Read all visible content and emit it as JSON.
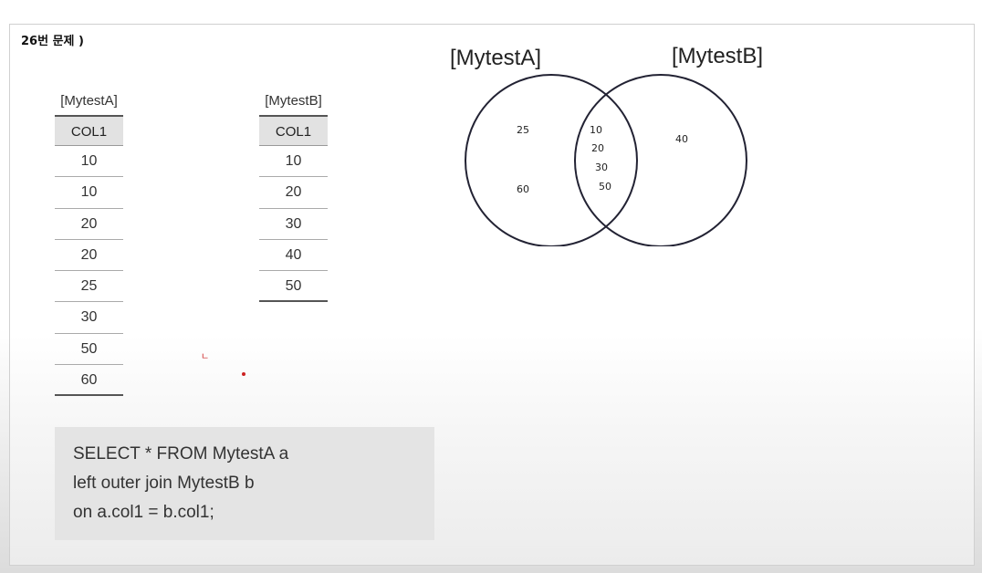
{
  "title": "26번 문제 )",
  "tableA": {
    "name": "[MytestA]",
    "header": "COL1",
    "rows": [
      "10",
      "10",
      "20",
      "20",
      "25",
      "30",
      "50",
      "60"
    ]
  },
  "tableB": {
    "name": "[MytestB]",
    "header": "COL1",
    "rows": [
      "10",
      "20",
      "30",
      "40",
      "50"
    ]
  },
  "venn": {
    "labelA": "[MytestA]",
    "labelB": "[MytestB]",
    "onlyA": [
      "25",
      "60"
    ],
    "both": [
      "10",
      "20",
      "30",
      "50"
    ],
    "onlyB": [
      "40"
    ]
  },
  "sql": {
    "line1": "SELECT * FROM MytestA a",
    "line2": "left outer join MytestB b",
    "line3": "on a.col1 = b.col1;"
  },
  "annotation": "ㄴ"
}
